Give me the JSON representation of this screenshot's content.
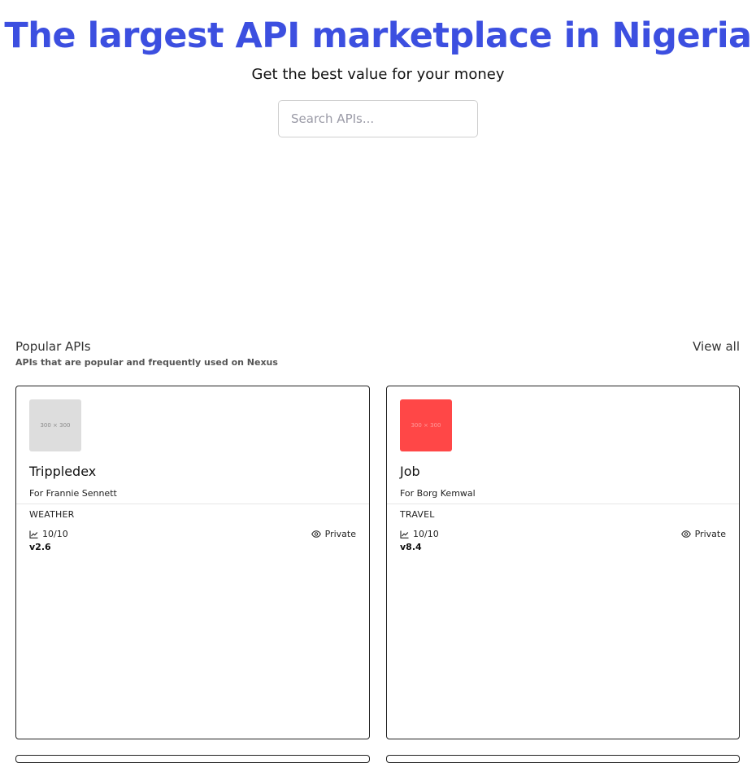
{
  "hero": {
    "title": "The largest API marketplace in Nigeria",
    "subtitle": "Get the best value for your money"
  },
  "search": {
    "placeholder": "Search APIs..."
  },
  "popular": {
    "title": "Popular APIs",
    "description": "APIs that are popular and frequently used on Nexus",
    "view_all": "View all",
    "cards": [
      {
        "thumb_label": "300 × 300",
        "thumb_color": "#dddddd",
        "thumb_text_color": "#8a8a8a",
        "name": "Trippledex",
        "owner": "For Frannie Sennett",
        "category": "WEATHER",
        "rating": "10/10",
        "visibility": "Private",
        "version": "v2.6"
      },
      {
        "thumb_label": "300 × 300",
        "thumb_color": "#ff4747",
        "thumb_text_color": "#ff9a9a",
        "name": "Job",
        "owner": "For Borg Kemwal",
        "category": "TRAVEL",
        "rating": "10/10",
        "visibility": "Private",
        "version": "v8.4"
      }
    ]
  },
  "colors": {
    "accent": "#3c4fe0"
  },
  "icons": {
    "rating": "chart-line-icon",
    "visibility": "eye-icon"
  }
}
